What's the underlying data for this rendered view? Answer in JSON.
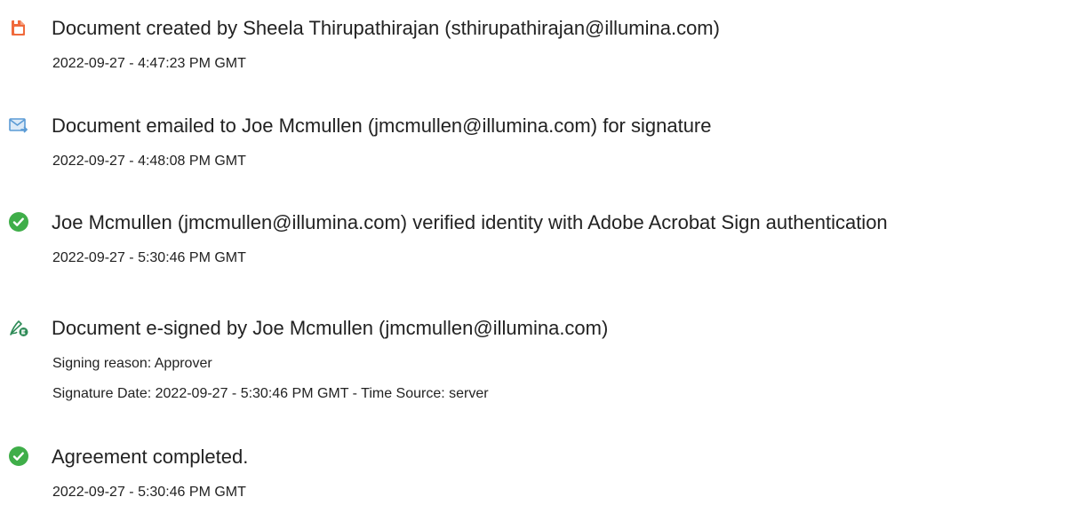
{
  "events": [
    {
      "icon": "document-created-icon",
      "title": "Document created by Sheela Thirupathirajan (sthirupathirajan@illumina.com)",
      "details": [
        "2022-09-27 - 4:47:23 PM GMT"
      ]
    },
    {
      "icon": "email-sent-icon",
      "title": "Document emailed to Joe Mcmullen (jmcmullen@illumina.com) for signature",
      "details": [
        "2022-09-27 - 4:48:08 PM GMT"
      ]
    },
    {
      "icon": "verified-check-icon",
      "title": "Joe Mcmullen (jmcmullen@illumina.com) verified identity with Adobe Acrobat Sign authentication",
      "details": [
        "2022-09-27 - 5:30:46 PM GMT"
      ]
    },
    {
      "icon": "e-signature-icon",
      "title": "Document e-signed by Joe Mcmullen (jmcmullen@illumina.com)",
      "details": [
        "Signing reason: Approver",
        "Signature Date: 2022-09-27 - 5:30:46 PM GMT - Time Source: server"
      ]
    },
    {
      "icon": "completed-check-icon",
      "title": "Agreement completed.",
      "details": [
        "2022-09-27 - 5:30:46 PM GMT"
      ]
    }
  ],
  "colors": {
    "document_icon": "#f06a3c",
    "email_icon": "#5b9bd5",
    "check_icon": "#3fae49",
    "signature_icon": "#2e8b57",
    "text": "#222222"
  }
}
